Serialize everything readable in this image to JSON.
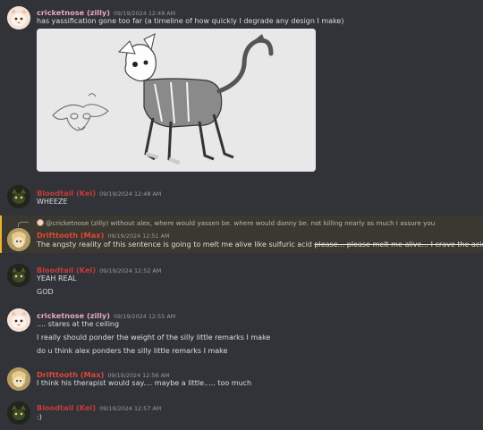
{
  "messages": [
    {
      "author": "cricketnose (zilly)",
      "timestamp": "09/19/2024 12:48 AM",
      "lines": [
        "has yassification gone too far (a timeline of how quickly I degrade any design I make)"
      ],
      "has_attachment": true
    },
    {
      "author": "Bloodtail (Kei)",
      "timestamp": "09/19/2024 12:48 AM",
      "lines": [
        "WHEEZE"
      ]
    },
    {
      "reply_to_author": "@cricketnose (zilly)",
      "reply_to_text": "without alex, where would yassen be. where would danny be. not killing nearly as much I assure you",
      "author": "Drifttooth (Max)",
      "timestamp": "09/19/2024 12:51 AM",
      "text_main": "The angsty reality of this sentence is going to melt me alive like sulfuric acid",
      "text_strike": "please... please melt me alive... I crave the acids..."
    },
    {
      "author": "Bloodtail (Kei)",
      "timestamp": "09/19/2024 12:52 AM",
      "lines": [
        "YEAH REAL",
        "GOD"
      ]
    },
    {
      "author": "cricketnose (zilly)",
      "timestamp": "09/19/2024 12:55 AM",
      "lines": [
        ".... stares at the ceiling",
        "I really should ponder the weight of the silly little remarks I make",
        "do u think alex ponders the silly little remarks I make"
      ]
    },
    {
      "author": "Drifttooth (Max)",
      "timestamp": "09/19/2024 12:56 AM",
      "lines": [
        "I think his therapist would say.... maybe a little..... too much"
      ]
    },
    {
      "author": "Bloodtail (Kei)",
      "timestamp": "09/19/2024 12:57 AM",
      "lines": [
        ":)"
      ]
    }
  ],
  "colors": {
    "background": "#313338",
    "cricketnose": "#e6a9bd",
    "bloodtail": "#c63b3b",
    "drifttooth": "#e2443c",
    "timestamp": "#949ba4",
    "mention_highlight": "#3a382f",
    "mention_border": "#f0b232"
  }
}
